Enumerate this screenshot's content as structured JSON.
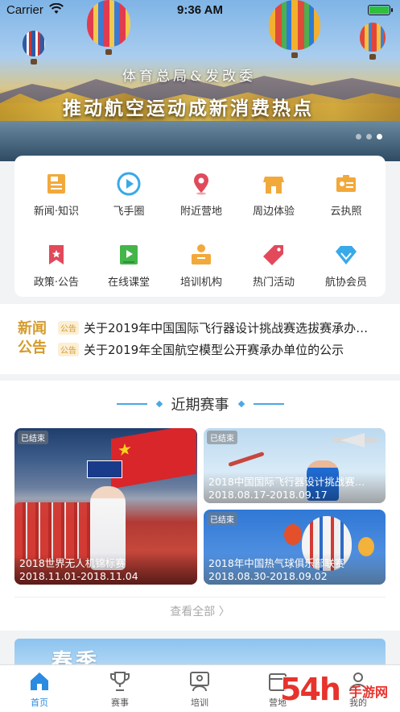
{
  "status_bar": {
    "carrier": "Carrier",
    "time": "9:36 AM"
  },
  "banner": {
    "caption_line1": "体育总局&发改委",
    "caption_line2": "推动航空运动成新消费热点",
    "pages": 3,
    "active_page": 3
  },
  "grid": [
    {
      "label": "新闻·知识",
      "icon": "news-icon",
      "color": "#f2a93b"
    },
    {
      "label": "飞手圈",
      "icon": "play-circle-icon",
      "color": "#39a9e8"
    },
    {
      "label": "附近营地",
      "icon": "location-pin-icon",
      "color": "#e2495a"
    },
    {
      "label": "周边体验",
      "icon": "shop-icon",
      "color": "#f2a93b"
    },
    {
      "label": "云执照",
      "icon": "id-card-icon",
      "color": "#f2a93b"
    },
    {
      "label": "政策·公告",
      "icon": "bookmark-icon",
      "color": "#e2495a"
    },
    {
      "label": "在线课堂",
      "icon": "video-book-icon",
      "color": "#43b549"
    },
    {
      "label": "培训机构",
      "icon": "lecturer-icon",
      "color": "#f2a93b"
    },
    {
      "label": "热门活动",
      "icon": "tag-icon",
      "color": "#e2495a"
    },
    {
      "label": "航协会员",
      "icon": "diamond-icon",
      "color": "#39a9e8"
    }
  ],
  "news": {
    "brand_line1": "新闻",
    "brand_line2": "公告",
    "items": [
      {
        "tag": "公告",
        "text": "关于2019年中国国际飞行器设计挑战赛选拔赛承办…"
      },
      {
        "tag": "公告",
        "text": "关于2019年全国航空模型公开赛承办单位的公示"
      }
    ]
  },
  "events": {
    "title": "近期赛事",
    "items": [
      {
        "status": "已结束",
        "name": "2018世界无人机锦标赛",
        "date": "2018.11.01-2018.11.04"
      },
      {
        "status": "已结束",
        "name": "2018中国国际飞行器设计挑战赛…",
        "date": "2018.08.17-2018.09.17"
      },
      {
        "status": "已结束",
        "name": "2018年中国热气球俱乐部联赛",
        "date": "2018.08.30-2018.09.02"
      }
    ],
    "view_all": "查看全部 〉"
  },
  "peek_banner": {
    "text": "春季"
  },
  "tabbar": [
    {
      "label": "首页",
      "icon": "home-icon",
      "active": true
    },
    {
      "label": "赛事",
      "icon": "trophy-icon",
      "active": false
    },
    {
      "label": "培训",
      "icon": "trainer-icon",
      "active": false
    },
    {
      "label": "营地",
      "icon": "camp-icon",
      "active": false
    },
    {
      "label": "我的",
      "icon": "user-icon",
      "active": false
    }
  ],
  "watermark": {
    "big": "54h",
    "small": "手游网",
    "suffix": "com"
  },
  "colors": {
    "accent": "#2a8be0",
    "news_gold": "#d59b2b",
    "divider_blue": "#4aa8e8"
  }
}
